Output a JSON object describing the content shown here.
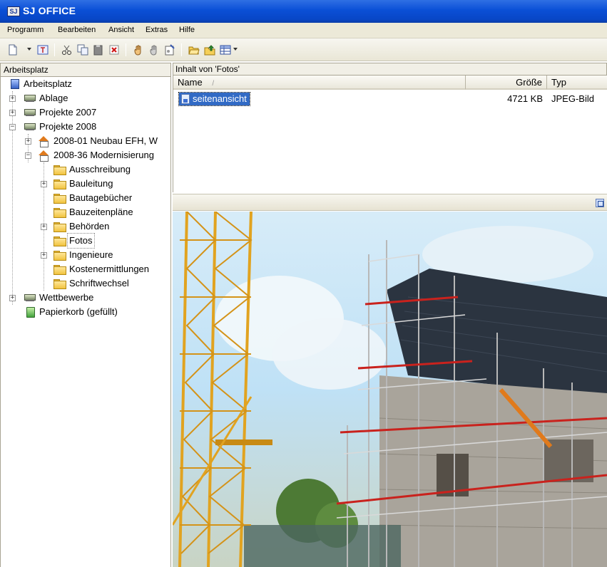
{
  "window": {
    "icon_text": "SJ",
    "title": "SJ OFFICE"
  },
  "menu": [
    "Programm",
    "Bearbeiten",
    "Ansicht",
    "Extras",
    "Hilfe"
  ],
  "toolbar": {
    "icons": [
      "new-document-icon",
      "text-template-icon",
      "cut-icon",
      "copy-icon",
      "paste-icon",
      "delete-icon",
      "hand-icon",
      "hand-share-icon",
      "properties-icon",
      "open-folder-icon",
      "folder-up-icon",
      "view-options-icon"
    ]
  },
  "left_panel": {
    "header": "Arbeitsplatz",
    "tree": [
      {
        "label": "Arbeitsplatz",
        "icon": "computer-icon",
        "level": 0,
        "expander": ""
      },
      {
        "label": "Ablage",
        "icon": "network-drive-icon",
        "level": 1,
        "expander": "+"
      },
      {
        "label": "Projekte 2007",
        "icon": "network-drive-icon",
        "level": 1,
        "expander": "+"
      },
      {
        "label": "Projekte 2008",
        "icon": "network-drive-icon",
        "level": 1,
        "expander": "−"
      },
      {
        "label": "2008-01 Neubau EFH, W",
        "icon": "house-icon",
        "level": 2,
        "expander": "+"
      },
      {
        "label": "2008-36 Modernisierung",
        "icon": "house-icon",
        "level": 2,
        "expander": "−"
      },
      {
        "label": "Ausschreibung",
        "icon": "folder-icon",
        "level": 3,
        "expander": ""
      },
      {
        "label": "Bauleitung",
        "icon": "folder-icon",
        "level": 3,
        "expander": "+"
      },
      {
        "label": "Bautagebücher",
        "icon": "folder-icon",
        "level": 3,
        "expander": ""
      },
      {
        "label": "Bauzeitenpläne",
        "icon": "folder-icon",
        "level": 3,
        "expander": ""
      },
      {
        "label": "Behörden",
        "icon": "folder-icon",
        "level": 3,
        "expander": "+"
      },
      {
        "label": "Fotos",
        "icon": "open-folder-icon",
        "level": 3,
        "expander": "",
        "selected": true
      },
      {
        "label": "Ingenieure",
        "icon": "folder-icon",
        "level": 3,
        "expander": "+"
      },
      {
        "label": "Kostenermittlungen",
        "icon": "folder-icon",
        "level": 3,
        "expander": ""
      },
      {
        "label": "Schriftwechsel",
        "icon": "folder-icon",
        "level": 3,
        "expander": ""
      },
      {
        "label": "Wettbewerbe",
        "icon": "network-drive-icon",
        "level": 1,
        "expander": "+"
      },
      {
        "label": "Papierkorb (gefüllt)",
        "icon": "recycle-bin-icon",
        "level": 1,
        "expander": ""
      }
    ]
  },
  "right_panel": {
    "header": "Inhalt von 'Fotos'",
    "columns": {
      "name": "Name",
      "sort_indicator": "/",
      "size": "Größe",
      "type": "Typ"
    },
    "files": [
      {
        "name": "seitenansicht",
        "size": "4721 KB",
        "type": "JPEG-Bild",
        "selected": true
      }
    ]
  },
  "colors": {
    "titlebar": "#0a4fd6",
    "selection": "#316ac5",
    "chrome": "#ece9d8",
    "crane": "#e1a320",
    "scaffold_red": "#c9221d",
    "roof": "#2b3440"
  }
}
